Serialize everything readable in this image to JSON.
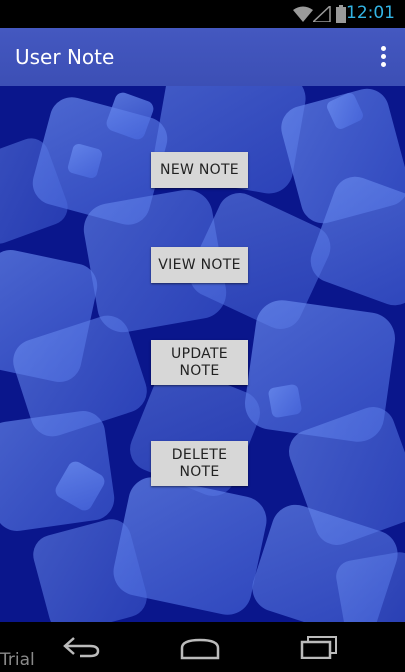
{
  "status_bar": {
    "time": "12:01",
    "icons": [
      "wifi-icon",
      "signal-icon",
      "battery-icon"
    ]
  },
  "action_bar": {
    "title": "User Note",
    "overflow_icon": "more-vert-icon"
  },
  "buttons": {
    "new_note": "NEW NOTE",
    "view_note": "VIEW NOTE",
    "update_note": "UPDATE\nNOTE",
    "delete_note": "DELETE\nNOTE"
  },
  "nav_bar": {
    "icons": [
      "back-icon",
      "home-icon",
      "recents-icon"
    ]
  },
  "watermark": "Trial",
  "colors": {
    "action_bar": "#3f51b5",
    "background": "#0a168c",
    "button": "#d7d7d7",
    "status_text": "#33b5e5"
  }
}
